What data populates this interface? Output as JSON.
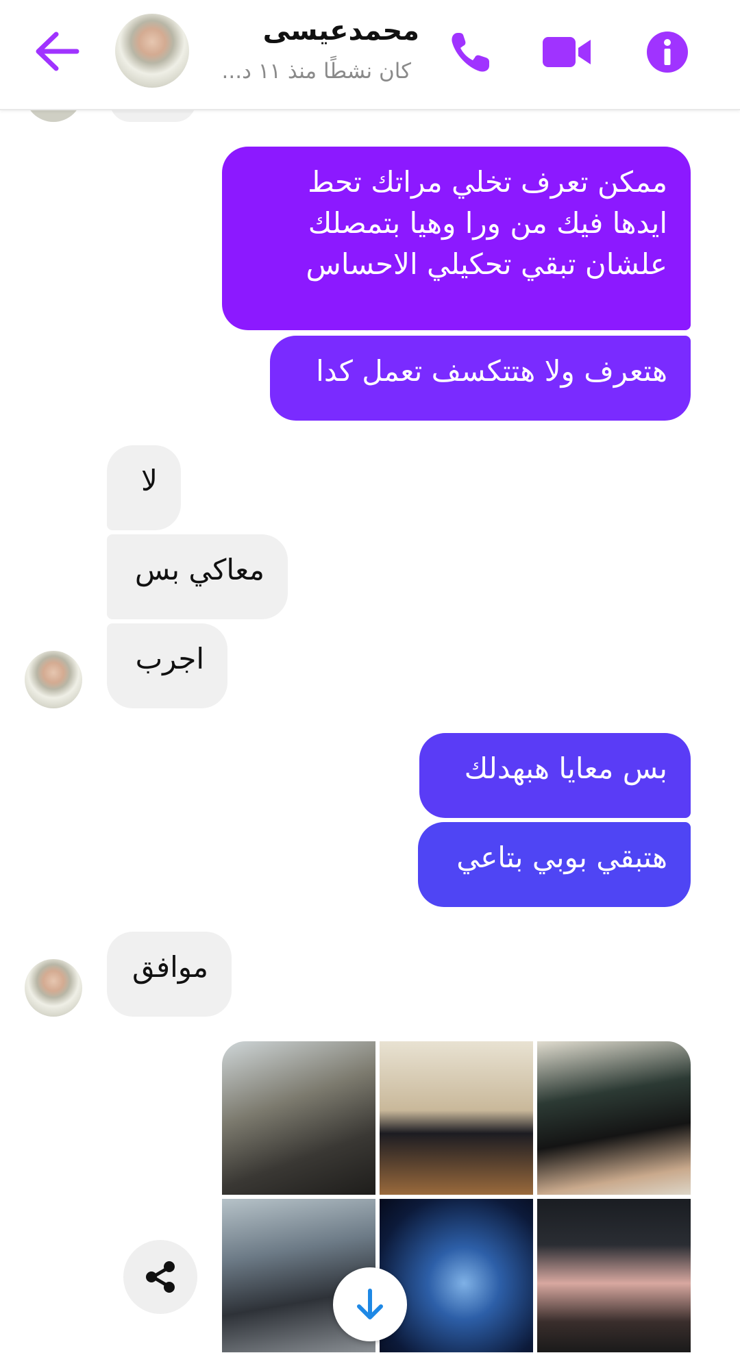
{
  "header": {
    "contact_name": "محمدعيسى",
    "status": "كان نشطًا منذ ١١ د...",
    "accent_color": "#a033ff",
    "icons": [
      "back-arrow-icon",
      "phone-icon",
      "video-camera-icon",
      "info-icon"
    ]
  },
  "messages": [
    {
      "side": "outgoing",
      "lines": [
        "ممكن تعرف تخلي مراتك تحط",
        "ايدها فيك من ورا وهيا بتمصلك",
        "علشان تبقي تحكيلي الاحساس"
      ]
    },
    {
      "side": "outgoing",
      "lines": [
        "هتعرف ولا هتتكسف تعمل كدا"
      ]
    },
    {
      "side": "incoming",
      "lines": [
        "لا"
      ]
    },
    {
      "side": "incoming",
      "lines": [
        "معاكي بس"
      ]
    },
    {
      "side": "incoming",
      "lines": [
        "اجرب"
      ]
    },
    {
      "side": "outgoing",
      "lines": [
        "بس معايا هبهدلك"
      ]
    },
    {
      "side": "outgoing",
      "lines": [
        "هتبقي بوبي بتاعي"
      ]
    },
    {
      "side": "incoming",
      "lines": [
        "موافق"
      ]
    }
  ],
  "colors": {
    "outgoing_purple": "#8c19ff",
    "outgoing_violet": "#7a2bff",
    "outgoing_blue": "#5a3cf6",
    "incoming_gray": "#f0f0f0",
    "scroll_arrow": "#1e88e5"
  },
  "controls": {
    "share_icon": "share-icon",
    "scroll_icon": "arrow-down-icon"
  }
}
